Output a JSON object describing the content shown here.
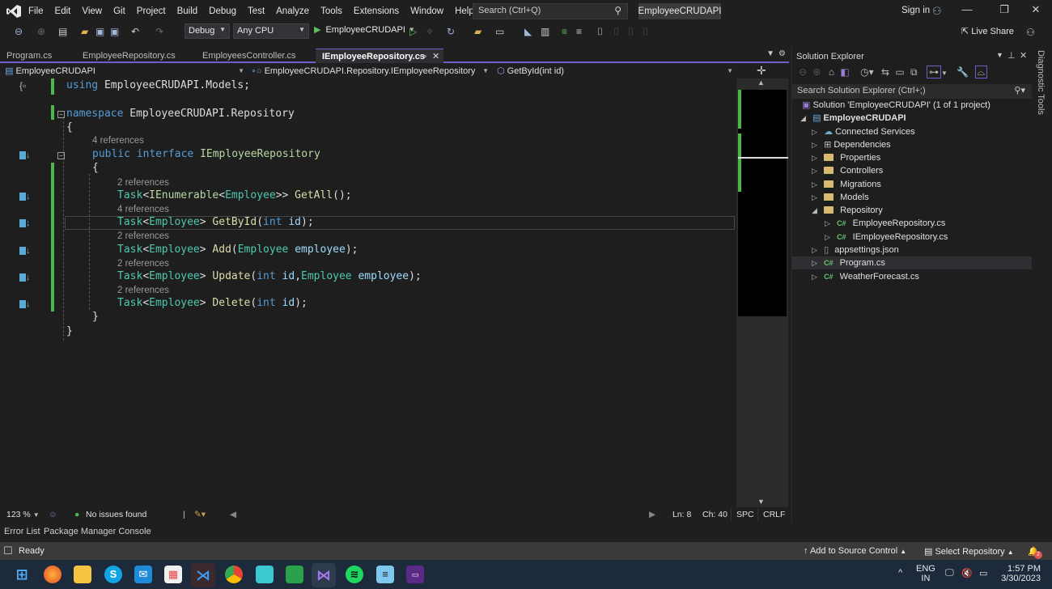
{
  "app": {
    "menu": [
      "File",
      "Edit",
      "View",
      "Git",
      "Project",
      "Build",
      "Debug",
      "Test",
      "Analyze",
      "Tools",
      "Extensions",
      "Window",
      "Help"
    ],
    "search_placeholder": "Search (Ctrl+Q)",
    "solution_title": "EmployeeCRUDAPI",
    "sign_in": "Sign in",
    "window_buttons": {
      "minimize": "—",
      "restore": "❐",
      "close": "✕"
    }
  },
  "toolbar": {
    "configuration": "Debug",
    "platform": "Any CPU",
    "run_target": "EmployeeCRUDAPI",
    "live_share": "Live Share"
  },
  "doc_tabs": [
    {
      "label": "Program.cs",
      "active": false
    },
    {
      "label": "EmployeeRepository.cs",
      "active": false
    },
    {
      "label": "EmployeesController.cs",
      "active": false
    },
    {
      "label": "IEmployeeRepository.cs",
      "active": true
    }
  ],
  "navbar": {
    "project": "EmployeeCRUDAPI",
    "type": "EmployeeCRUDAPI.Repository.IEmployeeRepository",
    "member": "GetById(int id)"
  },
  "code": {
    "using_kw": "using",
    "using_ns": " EmployeeCRUDAPI.Models;",
    "ns_kw": "namespace",
    "ns_name": " EmployeeCRUDAPI.Repository",
    "open_brace": "{",
    "close_brace": "}",
    "iface_refs": "4 references",
    "iface_public": "public",
    "iface_interface": "interface",
    "iface_name": "IEmployeeRepository",
    "methods": [
      {
        "refs": "2 references",
        "ret": "Task<IEnumerable<Employee>>",
        "name": "GetAll",
        "sig": "GetAll();"
      },
      {
        "refs": "4 references",
        "ret": "Task<Employee>",
        "name": "GetById",
        "sig": "GetById(int id);"
      },
      {
        "refs": "2 references",
        "ret": "Task<Employee>",
        "name": "Add",
        "sig": "Add(Employee employee);"
      },
      {
        "refs": "2 references",
        "ret": "Task<Employee>",
        "name": "Update",
        "sig": "Update(int id,Employee employee);"
      },
      {
        "refs": "2 references",
        "ret": "Task<Employee>",
        "name": "Delete",
        "sig": "Delete(int id);"
      }
    ]
  },
  "editor_status": {
    "zoom": "123 %",
    "issues": "No issues found",
    "line": "Ln: 8",
    "col": "Ch: 40",
    "whitespace": "SPC",
    "line_ending": "CRLF"
  },
  "solution_explorer": {
    "title": "Solution Explorer",
    "search_placeholder": "Search Solution Explorer (Ctrl+;)",
    "solution": "Solution 'EmployeeCRUDAPI' (1 of 1 project)",
    "project": "EmployeeCRUDAPI",
    "items": [
      {
        "label": "Connected Services",
        "icon": "connected-services-icon"
      },
      {
        "label": "Dependencies",
        "icon": "dependencies-icon"
      },
      {
        "label": "Properties",
        "icon": "properties-icon"
      },
      {
        "label": "Controllers",
        "icon": "folder-icon"
      },
      {
        "label": "Migrations",
        "icon": "folder-icon"
      },
      {
        "label": "Models",
        "icon": "folder-icon"
      },
      {
        "label": "Repository",
        "icon": "folder-icon",
        "expanded": true
      },
      {
        "label": "EmployeeRepository.cs",
        "icon": "csharp-file-icon",
        "child": true
      },
      {
        "label": "IEmployeeRepository.cs",
        "icon": "csharp-file-icon",
        "child": true
      },
      {
        "label": "appsettings.json",
        "icon": "json-file-icon"
      },
      {
        "label": "Program.cs",
        "icon": "csharp-file-icon",
        "selected": true
      },
      {
        "label": "WeatherForecast.cs",
        "icon": "csharp-file-icon"
      }
    ]
  },
  "side_strip": {
    "label": "Diagnostic Tools"
  },
  "bottom_tabs": [
    "Error List",
    "Package Manager Console"
  ],
  "statusbar": {
    "ready": "Ready",
    "add_source": "Add to Source Control",
    "select_repo": "Select Repository",
    "notifications": "2"
  },
  "taskbar": {
    "apps": [
      "start",
      "firefox",
      "file-explorer",
      "skype",
      "mail",
      "store",
      "vscode",
      "chrome",
      "app-h1",
      "chat",
      "visual-studio",
      "spotify",
      "notepad",
      "terminal"
    ],
    "lang_top": "ENG",
    "lang_bottom": "IN",
    "time": "1:57 PM",
    "date": "3/30/2023"
  }
}
